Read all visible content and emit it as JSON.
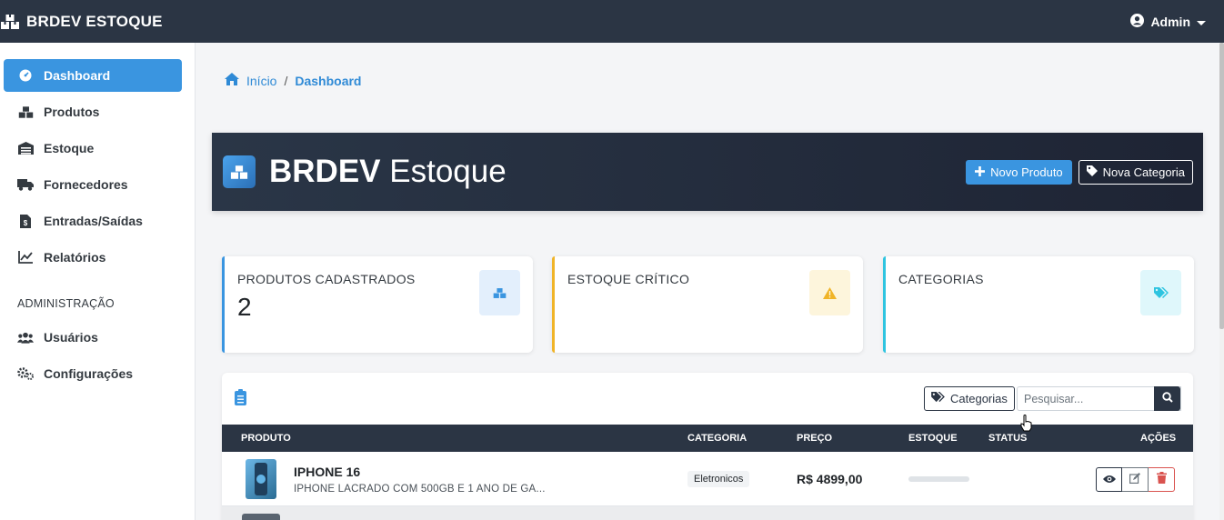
{
  "topbar": {
    "brand": "BRDEV ESTOQUE",
    "user": "Admin",
    "user_icon": "user-circle-icon",
    "caret_icon": "caret-down-icon"
  },
  "sidebar": {
    "items": [
      {
        "label": "Dashboard",
        "icon": "tachometer-icon",
        "active": true
      },
      {
        "label": "Produtos",
        "icon": "boxes-icon",
        "active": false
      },
      {
        "label": "Estoque",
        "icon": "warehouse-icon",
        "active": false
      },
      {
        "label": "Fornecedores",
        "icon": "truck-icon",
        "active": false
      },
      {
        "label": "Entradas/Saídas",
        "icon": "file-invoice-dollar-icon",
        "active": false
      },
      {
        "label": "Relatórios",
        "icon": "chart-line-icon",
        "active": false
      }
    ],
    "admin_section": "ADMINISTRAÇÃO",
    "admin_items": [
      {
        "label": "Usuários",
        "icon": "users-icon"
      },
      {
        "label": "Configurações",
        "icon": "cogs-icon"
      }
    ]
  },
  "breadcrumb": {
    "home": "Início",
    "separator": "/",
    "current": "Dashboard"
  },
  "hero": {
    "title_bold": "BRDEV",
    "title_light": "Estoque",
    "new_product": "Novo Produto",
    "new_category": "Nova Categoria"
  },
  "cards": [
    {
      "label": "PRODUTOS CADASTRADOS",
      "value": "2",
      "accent": "#3a95e0",
      "icon": "boxes-icon"
    },
    {
      "label": "ESTOQUE CRÍTICO",
      "value": "",
      "accent": "#f0b428",
      "icon": "warning-icon"
    },
    {
      "label": "CATEGORIAS",
      "value": "",
      "accent": "#2ec4e0",
      "icon": "tags-icon"
    }
  ],
  "table": {
    "categories_button": "Categorias",
    "search_placeholder": "Pesquisar...",
    "columns": [
      "PRODUTO",
      "CATEGORIA",
      "PREÇO",
      "ESTOQUE",
      "STATUS",
      "AÇÕES"
    ],
    "rows": [
      {
        "name": "IPHONE 16",
        "description": "IPHONE LACRADO COM 500GB E 1 ANO DE GA...",
        "category": "Eletronicos",
        "price": "R$ 4899,00",
        "status": ""
      }
    ]
  }
}
